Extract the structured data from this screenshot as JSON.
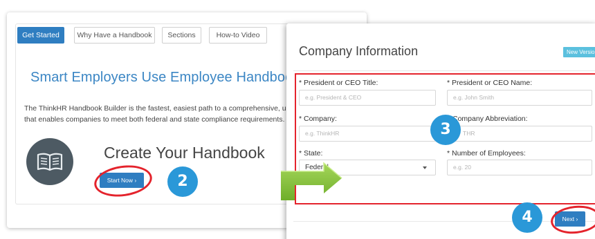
{
  "left_panel": {
    "tabs": [
      {
        "label": "Get Started",
        "active": true
      },
      {
        "label": "Why Have a Handbook",
        "active": false
      },
      {
        "label": "Sections",
        "active": false
      },
      {
        "label": "How-to Video",
        "active": false
      }
    ],
    "heading": "Smart Employers Use Employee Handbooks",
    "description": "The ThinkHR Handbook Builder is the fastest, easiest path to a comprehensive, up-to-date e handbook that enables companies to meet both federal and state compliance requirements.",
    "create_title": "Create Your Handbook",
    "start_button": "Start Now ›",
    "book_icon": "open-book-icon"
  },
  "right_panel": {
    "title": "Company Information",
    "version_badge": "New Version",
    "fields": [
      {
        "label": "* President or CEO Title:",
        "placeholder": "e.g. President & CEO",
        "value": ""
      },
      {
        "label": "* President or CEO Name:",
        "placeholder": "e.g. John Smith",
        "value": ""
      },
      {
        "label": "* Company:",
        "placeholder": "e.g. ThinkHR",
        "value": ""
      },
      {
        "label": "Company Abbreviation:",
        "placeholder": "THR",
        "value": ""
      },
      {
        "label": "* State:",
        "placeholder": "",
        "value": "Federal",
        "type": "select"
      },
      {
        "label": "* Number of Employees:",
        "placeholder": "e.g. 20",
        "value": ""
      }
    ],
    "next_button": "Next ›"
  },
  "step_badges": [
    "2",
    "3",
    "4"
  ],
  "colors": {
    "accent_blue": "#2f7ec1",
    "heading_blue": "#3b86c4",
    "badge_blue": "#2a98d8",
    "highlight_red": "#e4232c",
    "arrow_green": "#8cc63f",
    "version_badge": "#5bc0de"
  }
}
